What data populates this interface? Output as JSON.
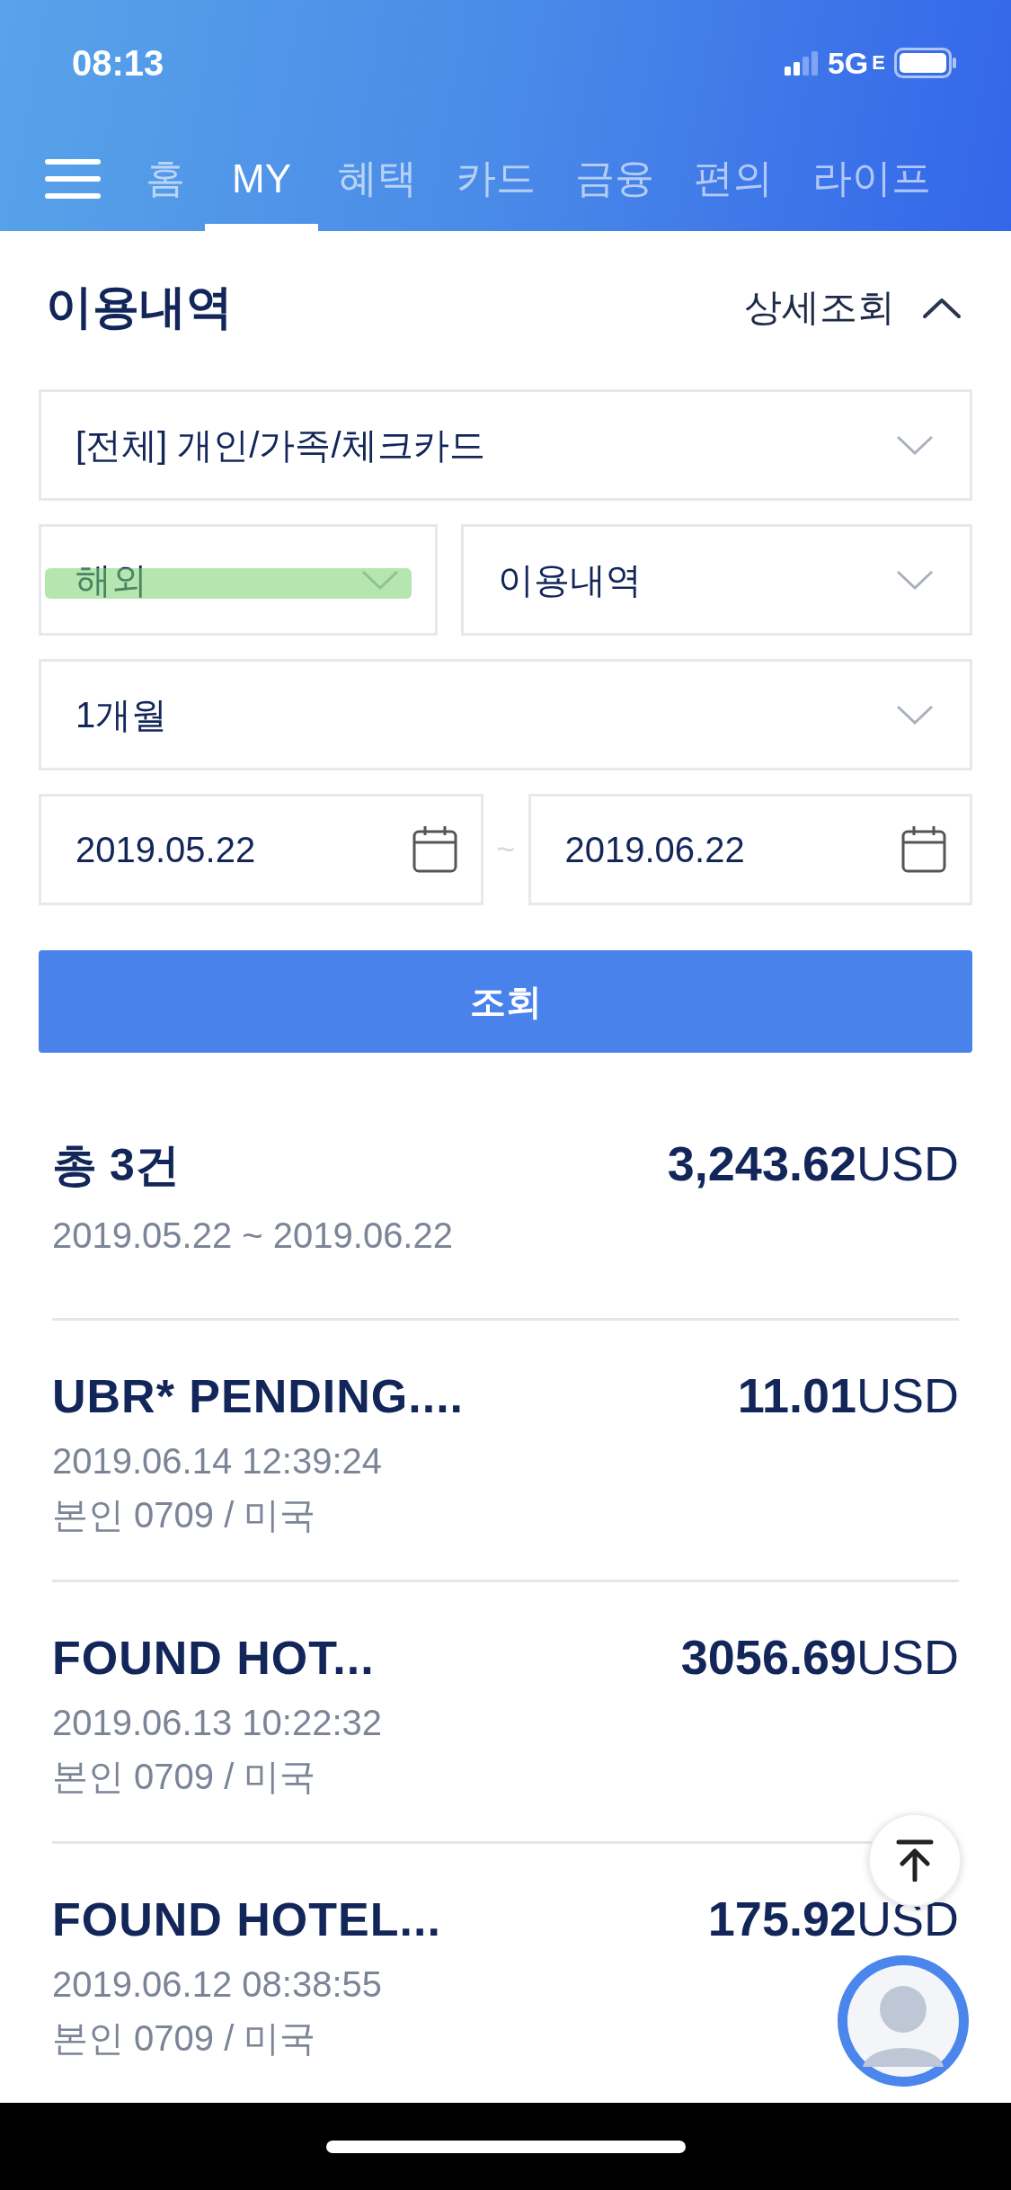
{
  "status_bar": {
    "time": "08:13",
    "network": "5G",
    "network_suffix": "E"
  },
  "nav": {
    "tabs": [
      {
        "label": "홈",
        "selected": false
      },
      {
        "label": "MY",
        "selected": true
      },
      {
        "label": "혜택",
        "selected": false
      },
      {
        "label": "카드",
        "selected": false
      },
      {
        "label": "금융",
        "selected": false
      },
      {
        "label": "편의",
        "selected": false
      },
      {
        "label": "라이프",
        "selected": false
      }
    ]
  },
  "section": {
    "title": "이용내역",
    "detail_toggle": {
      "label": "상세조회",
      "expanded": true
    }
  },
  "filters": {
    "card_type": "[전체] 개인/가족/체크카드",
    "region": {
      "value": "해외",
      "highlighted": true
    },
    "history_type": "이용내역",
    "period": "1개월",
    "start_date": "2019.05.22",
    "range_separator": "~",
    "end_date": "2019.06.22"
  },
  "search_button": "조회",
  "summary": {
    "count": "총 3건",
    "range": "2019.05.22 ~ 2019.06.22",
    "total": "**3,243.62**USD"
  },
  "transactions": [
    {
      "merchant": "UBR* PENDING....",
      "amount": "**11.01**USD",
      "datetime": "2019.06.14 12:39:24",
      "detail": "본인 0709 / 미국"
    },
    {
      "merchant": "FOUND HOT...",
      "amount": "**3056.69**USD",
      "datetime": "2019.06.13 10:22:32",
      "detail": "본인 0709 / 미국"
    },
    {
      "merchant": "FOUND HOTEL...",
      "amount": "**175.92**USD",
      "datetime": "2019.06.12 08:38:55",
      "detail": "본인 0709 / 미국"
    }
  ]
}
